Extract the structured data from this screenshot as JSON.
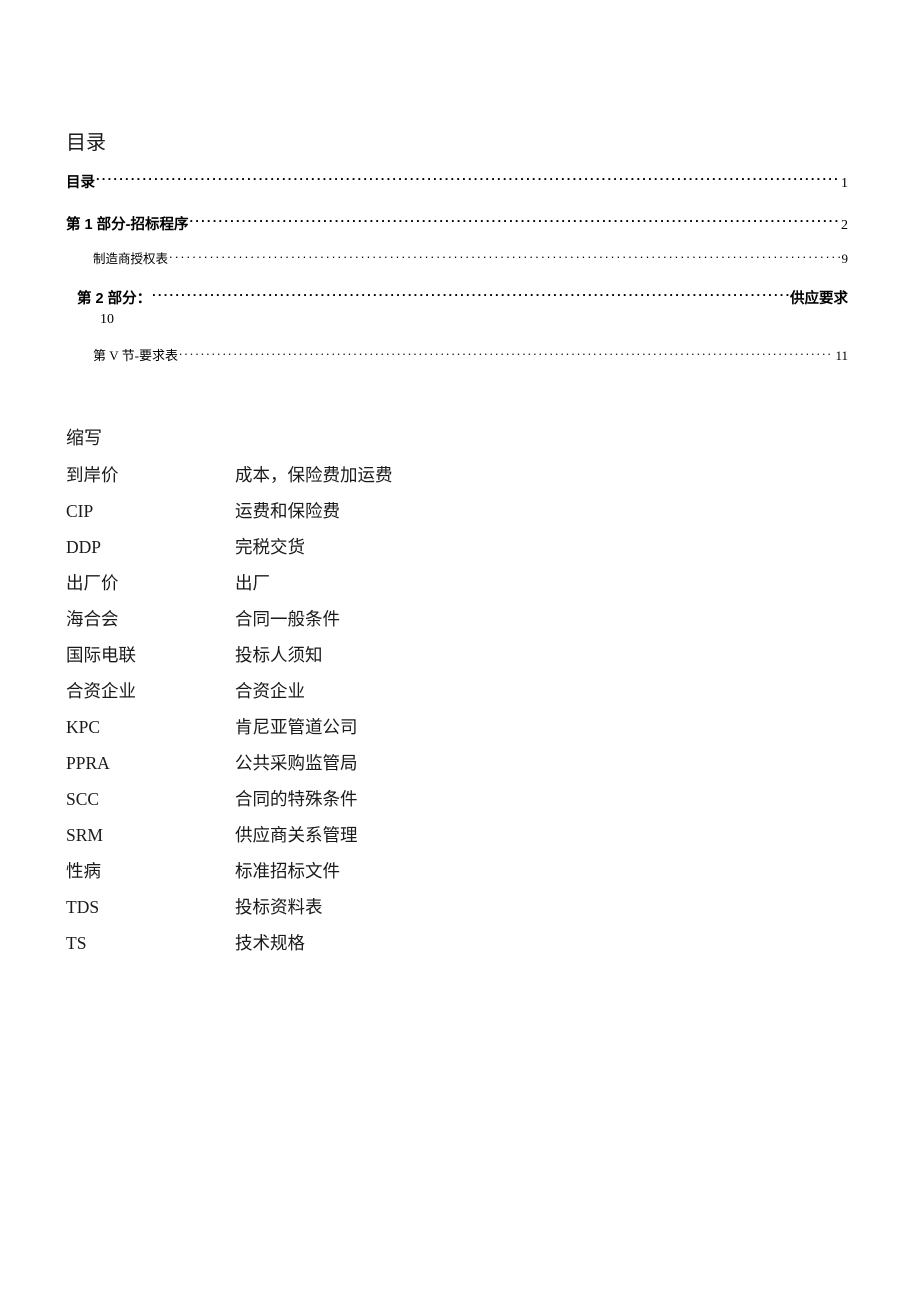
{
  "document": {
    "toc_heading": "目录",
    "abbr_heading": "缩写"
  },
  "toc": {
    "entries": [
      {
        "label": "目录",
        "page": "1",
        "level": 1
      },
      {
        "label": "第 1 部分-招标程序",
        "page": "2",
        "level": 1
      },
      {
        "label": "制造商授权表",
        "page": "9",
        "level": 2
      },
      {
        "label": "第 2 部分：",
        "tail": "供应要求",
        "page": "10",
        "level": 1,
        "wrapped": true
      },
      {
        "label": "第 V 节-要求表",
        "page": "11",
        "level": 2
      }
    ]
  },
  "abbreviations": {
    "rows": [
      {
        "term": "到岸价",
        "definition": "成本，保险费加运费"
      },
      {
        "term": "CIP",
        "definition": "运费和保险费"
      },
      {
        "term": "DDP",
        "definition": "完税交货"
      },
      {
        "term": "出厂价",
        "definition": "出厂"
      },
      {
        "term": "海合会",
        "definition": "合同一般条件"
      },
      {
        "term": "国际电联",
        "definition": "投标人须知"
      },
      {
        "term": "合资企业",
        "definition": "合资企业"
      },
      {
        "term": "KPC",
        "definition": "肯尼亚管道公司"
      },
      {
        "term": "PPRA",
        "definition": "公共采购监管局"
      },
      {
        "term": "SCC",
        "definition": "合同的特殊条件"
      },
      {
        "term": "SRM",
        "definition": "供应商关系管理"
      },
      {
        "term": "性病",
        "definition": "标准招标文件"
      },
      {
        "term": "TDS",
        "definition": "投标资料表"
      },
      {
        "term": "TS",
        "definition": "技术规格"
      }
    ]
  }
}
